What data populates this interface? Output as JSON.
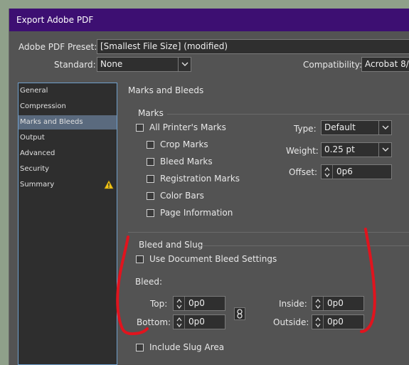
{
  "window": {
    "title": "Export Adobe PDF"
  },
  "top": {
    "preset_label": "Adobe PDF Preset:",
    "preset_value": "[Smallest File Size] (modified)",
    "standard_label": "Standard:",
    "standard_value": "None",
    "compat_label": "Compatibility:",
    "compat_value": "Acrobat 8/"
  },
  "sidebar": {
    "items": [
      {
        "label": "General"
      },
      {
        "label": "Compression"
      },
      {
        "label": "Marks and Bleeds"
      },
      {
        "label": "Output"
      },
      {
        "label": "Advanced"
      },
      {
        "label": "Security"
      },
      {
        "label": "Summary"
      }
    ],
    "selected": "Marks and Bleeds",
    "warning_icon": "warning-triangle-icon"
  },
  "main": {
    "heading": "Marks and Bleeds",
    "marks": {
      "group_title": "Marks",
      "all_printers": "All Printer's Marks",
      "crop": "Crop Marks",
      "bleed": "Bleed Marks",
      "registration": "Registration Marks",
      "color_bars": "Color Bars",
      "page_info": "Page Information",
      "type_label": "Type:",
      "type_value": "Default",
      "weight_label": "Weight:",
      "weight_value": "0.25 pt",
      "offset_label": "Offset:",
      "offset_value": "0p6"
    },
    "bleed_slug": {
      "group_title": "Bleed and Slug",
      "use_doc": "Use Document Bleed Settings",
      "bleed_label": "Bleed:",
      "top_label": "Top:",
      "top_value": "0p0",
      "bottom_label": "Bottom:",
      "bottom_value": "0p0",
      "inside_label": "Inside:",
      "inside_value": "0p0",
      "outside_label": "Outside:",
      "outside_value": "0p0",
      "include_slug": "Include Slug Area"
    }
  },
  "colors": {
    "titlebar": "#3d0f72",
    "annotation": "#e0141e",
    "selected_nav": "#5a6a7e"
  }
}
